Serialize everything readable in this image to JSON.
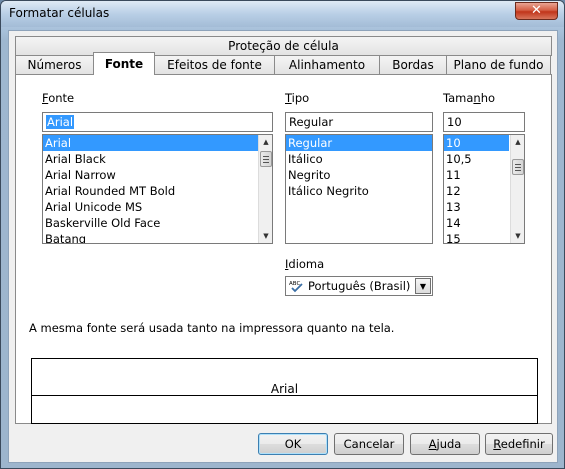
{
  "window": {
    "title": "Formatar células",
    "close_glyph": "✕"
  },
  "tabs": {
    "back_row": [
      {
        "label": "Proteção de célula"
      }
    ],
    "front_row": [
      {
        "label": "Números"
      },
      {
        "label": "Fonte",
        "active": true
      },
      {
        "label": "Efeitos de fonte"
      },
      {
        "label": "Alinhamento"
      },
      {
        "label": "Bordas"
      },
      {
        "label": "Plano de fundo"
      }
    ]
  },
  "font": {
    "label_accel": "F",
    "label_rest": "onte",
    "value": "Arial",
    "items": [
      "Arial",
      "Arial Black",
      "Arial Narrow",
      "Arial Rounded MT Bold",
      "Arial Unicode MS",
      "Baskerville Old Face",
      "Batang"
    ],
    "selected_index": 0
  },
  "style": {
    "label_accel": "T",
    "label_rest": "ipo",
    "value": "Regular",
    "items": [
      "Regular",
      "Itálico",
      "Negrito",
      "Itálico Negrito"
    ],
    "selected_index": 0
  },
  "size": {
    "label_pre": "Tama",
    "label_accel": "n",
    "label_rest": "ho",
    "value": "10",
    "items": [
      "10",
      "10,5",
      "11",
      "12",
      "13",
      "14",
      "15"
    ],
    "selected_index": 0
  },
  "language": {
    "label_accel": "I",
    "label_rest": "dioma",
    "value": "Português (Brasil)",
    "icon": "spellcheck-icon"
  },
  "info_text": "A mesma fonte será usada tanto na impressora quanto na tela.",
  "preview": {
    "text": "Arial"
  },
  "buttons": {
    "ok": "OK",
    "cancel": "Cancelar",
    "help_accel": "A",
    "help_rest": "juda",
    "reset_accel": "R",
    "reset_rest": "edefinir"
  },
  "colors": {
    "selection": "#3399ff",
    "window_frame": "#a9c2db",
    "close_button": "#c1351a"
  }
}
